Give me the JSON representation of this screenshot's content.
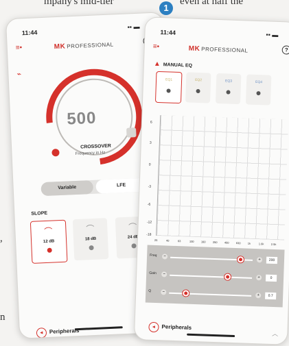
{
  "captions": {
    "left": "mpany's mid-tier",
    "right": "even at half the"
  },
  "margin_text": [
    ",",
    "n"
  ],
  "badge": "1",
  "left_phone": {
    "time": "11:44",
    "brand": "PROFESSIONAL",
    "crossover": {
      "value": "500",
      "label": "CROSSOVER",
      "sub": "Frequency in Hz"
    },
    "segment": {
      "options": [
        "Variable",
        "LFE"
      ]
    },
    "slope": {
      "title": "SLOPE",
      "options": [
        {
          "label": "12 dB",
          "selected": true
        },
        {
          "label": "18 dB",
          "selected": false
        },
        {
          "label": "24 dB",
          "selected": false
        }
      ]
    },
    "footer": "Peripherals"
  },
  "right_phone": {
    "time": "11:44",
    "brand": "PROFESSIONAL",
    "section_title": "MANUAL EQ",
    "eq_presets": [
      "EQ1",
      "EQ2",
      "EQ3",
      "EQ4"
    ],
    "graph_y_labels": [
      "6",
      "3",
      "0",
      "-3",
      "-6",
      "-12",
      "-18"
    ],
    "graph_x_labels": [
      "25",
      "40",
      "63",
      "100",
      "160",
      "250",
      "400",
      "630",
      "1k",
      "1.6k",
      "2.5k"
    ],
    "controls": [
      {
        "name": "Freq",
        "value": "200",
        "level": 0.85
      },
      {
        "name": "Gain",
        "value": "0",
        "level": 0.7
      },
      {
        "name": "Q",
        "value": "0.7",
        "level": 0.2
      }
    ],
    "footer": "Peripherals"
  }
}
